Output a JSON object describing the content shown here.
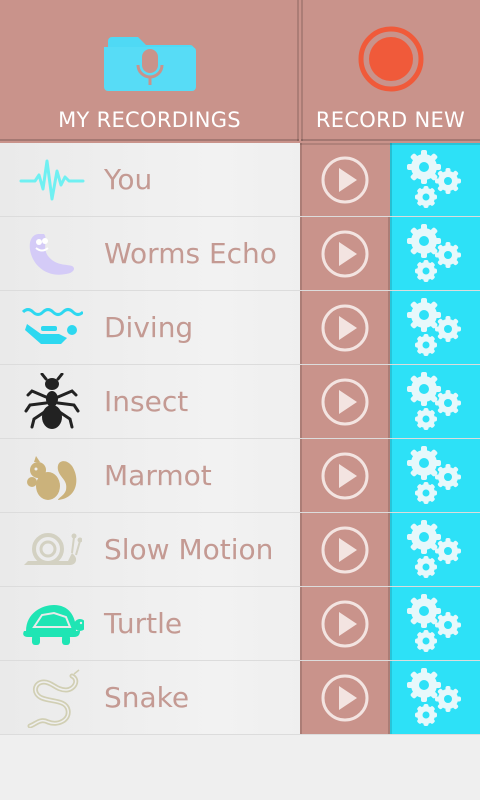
{
  "header": {
    "my_recordings_label": "MY RECORDINGS",
    "record_new_label": "RECORD NEW",
    "colors": {
      "header_bg": "#c9938b",
      "folder": "#4fd9f5",
      "record": "#f05a3a"
    }
  },
  "effects": [
    {
      "name": "You",
      "icon": "waveform-icon"
    },
    {
      "name": "Worms Echo",
      "icon": "worm-icon"
    },
    {
      "name": "Diving",
      "icon": "diver-icon"
    },
    {
      "name": "Insect",
      "icon": "ant-icon"
    },
    {
      "name": "Marmot",
      "icon": "squirrel-icon"
    },
    {
      "name": "Slow Motion",
      "icon": "snail-icon"
    },
    {
      "name": "Turtle",
      "icon": "turtle-icon"
    },
    {
      "name": "Snake",
      "icon": "snake-icon"
    }
  ],
  "colors": {
    "effect_text": "#c49a93",
    "play_bg": "#c9938b",
    "settings_bg": "#2de1f7"
  }
}
